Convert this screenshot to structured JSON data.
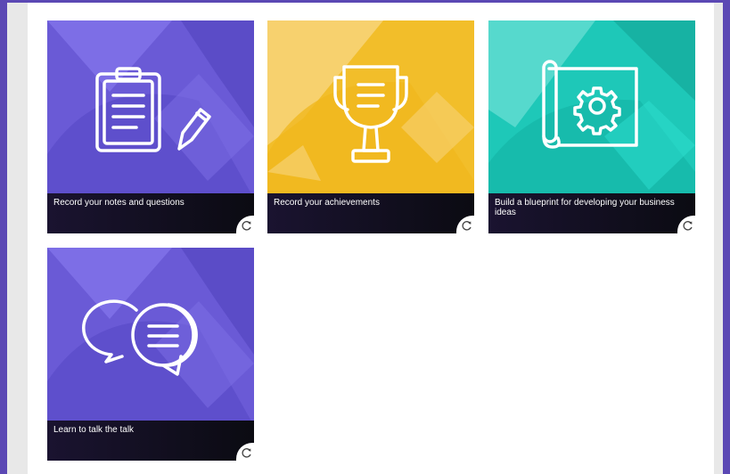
{
  "cards": [
    {
      "caption": "Record your notes and questions",
      "icon": "clipboard-pencil-icon",
      "color": "#6a5ad6"
    },
    {
      "caption": "Record your achievements",
      "icon": "trophy-icon",
      "color": "#f2be2a"
    },
    {
      "caption": "Build a blueprint for developing your business ideas",
      "icon": "blueprint-gear-icon",
      "color": "#1ec8b8"
    },
    {
      "caption": "Learn to talk the talk",
      "icon": "chat-bubbles-icon",
      "color": "#6a5ad6"
    }
  ],
  "flip_icon": "refresh-icon",
  "frame_color": "#5b48b4"
}
